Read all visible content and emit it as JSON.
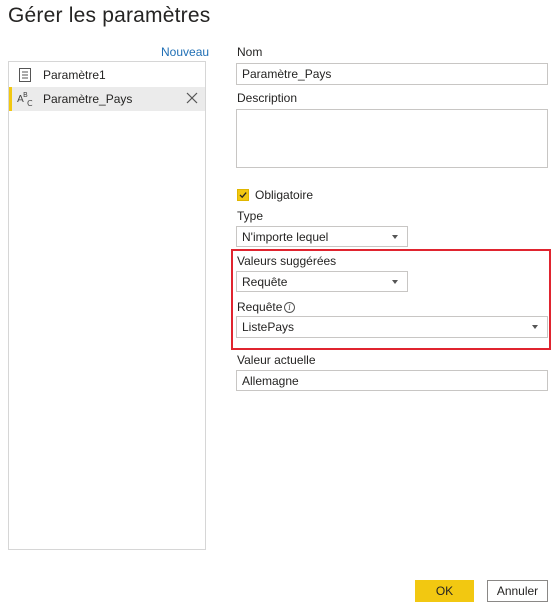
{
  "dialog": {
    "title": "Gérer les paramètres"
  },
  "sidebar": {
    "new_label": "Nouveau",
    "items": [
      {
        "label": "Paramètre1",
        "icon": "list-icon",
        "selected": false
      },
      {
        "label": "Paramètre_Pays",
        "icon": "abc-type-icon",
        "selected": true
      }
    ]
  },
  "form": {
    "name_label": "Nom",
    "name_value": "Paramètre_Pays",
    "description_label": "Description",
    "description_value": "",
    "required_label": "Obligatoire",
    "required_checked": true,
    "type_label": "Type",
    "type_value": "N'importe lequel",
    "suggested_label": "Valeurs suggérées",
    "suggested_value": "Requête",
    "query_label": "Requête",
    "query_value": "ListePays",
    "current_label": "Valeur actuelle",
    "current_value": "Allemagne"
  },
  "buttons": {
    "ok": "OK",
    "cancel": "Annuler"
  },
  "colors": {
    "accent": "#f2c811",
    "highlight": "#e0242f",
    "link": "#1f6fb5"
  }
}
